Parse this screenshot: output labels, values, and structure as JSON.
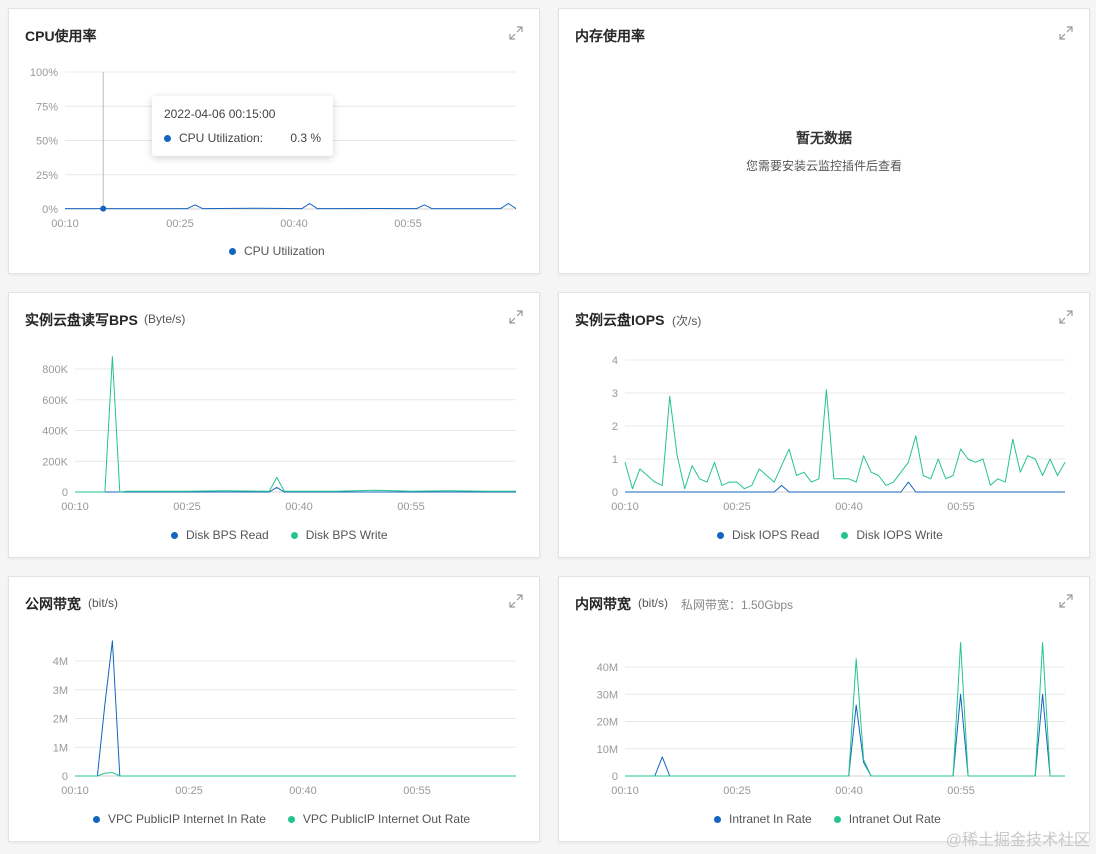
{
  "colors": {
    "blue": "#1464c0",
    "green": "#24c48c",
    "grid": "#e8e8e8",
    "tick": "#999999"
  },
  "cpu": {
    "title": "CPU使用率",
    "tooltip": {
      "time": "2022-04-06 00:15:00",
      "series": "CPU Utilization:",
      "value": "0.3 %"
    },
    "legend": [
      "CPU Utilization"
    ]
  },
  "memory": {
    "title": "内存使用率",
    "empty_title": "暂无数据",
    "empty_desc": "您需要安装云监控插件后查看"
  },
  "disk_bps": {
    "title": "实例云盘读写BPS",
    "unit": "(Byte/s)",
    "legend": [
      "Disk BPS Read",
      "Disk BPS Write"
    ]
  },
  "disk_iops": {
    "title": "实例云盘IOPS",
    "unit": "(次/s)",
    "legend": [
      "Disk IOPS Read",
      "Disk IOPS Write"
    ]
  },
  "public_bw": {
    "title": "公网带宽",
    "unit": "(bit/s)",
    "legend": [
      "VPC PublicIP Internet In Rate",
      "VPC PublicIP Internet Out Rate"
    ]
  },
  "private_bw": {
    "title": "内网带宽",
    "unit": "(bit/s)",
    "extra": "私网带宽：1.50Gbps",
    "legend": [
      "Intranet In Rate",
      "Intranet Out Rate"
    ]
  },
  "watermark": "@稀土掘金技术社区",
  "chart_data": [
    {
      "id": "cpu",
      "type": "line",
      "x_ticks": [
        "00:10",
        "00:25",
        "00:40",
        "00:55"
      ],
      "y_ticks": [
        "100%",
        "75%",
        "50%",
        "25%",
        "0%"
      ],
      "ylim": [
        0,
        100
      ],
      "xlim": [
        10,
        69
      ],
      "series": [
        {
          "name": "CPU Utilization",
          "color": "#1464c0",
          "x": [
            10,
            15,
            26,
            27,
            28,
            35,
            41,
            42,
            43,
            50,
            56,
            57,
            58,
            67,
            68,
            69
          ],
          "y": [
            0.3,
            0.3,
            0.3,
            3,
            0.3,
            0.5,
            0.3,
            4,
            0.3,
            0.4,
            0.3,
            3,
            0.3,
            0.3,
            4,
            0.3
          ]
        }
      ]
    },
    {
      "id": "disk_bps",
      "type": "line",
      "x_ticks": [
        "00:10",
        "00:25",
        "00:40",
        "00:55"
      ],
      "y_ticks": [
        "800K",
        "600K",
        "400K",
        "200K",
        "0"
      ],
      "ylim": [
        0,
        900
      ],
      "xlim": [
        10,
        69
      ],
      "series": [
        {
          "name": "Disk BPS Read",
          "color": "#1464c0",
          "x": [
            10,
            15,
            16,
            17,
            36,
            37,
            38,
            69
          ],
          "y": [
            0,
            0,
            0,
            0,
            0,
            30,
            0,
            0
          ]
        },
        {
          "name": "Disk BPS Write",
          "color": "#24c48c",
          "x": [
            10,
            14,
            15,
            16,
            17,
            20,
            25,
            30,
            36,
            37,
            38,
            45,
            50,
            55,
            60,
            65,
            69
          ],
          "y": [
            0,
            0,
            880,
            0,
            5,
            5,
            5,
            8,
            5,
            95,
            5,
            5,
            12,
            5,
            8,
            5,
            5
          ]
        }
      ]
    },
    {
      "id": "disk_iops",
      "type": "line",
      "x_ticks": [
        "00:10",
        "00:25",
        "00:40",
        "00:55"
      ],
      "y_ticks": [
        "4",
        "3",
        "2",
        "1",
        "0"
      ],
      "ylim": [
        0,
        4
      ],
      "xlim": [
        10,
        69
      ],
      "series": [
        {
          "name": "Disk IOPS Read",
          "color": "#1464c0",
          "x": [
            10,
            30,
            31,
            32,
            47,
            48,
            49,
            69
          ],
          "y": [
            0,
            0,
            0.2,
            0,
            0,
            0.3,
            0,
            0
          ]
        },
        {
          "name": "Disk IOPS Write",
          "color": "#24c48c",
          "x": [
            10,
            11,
            12,
            13,
            14,
            15,
            16,
            17,
            18,
            19,
            20,
            21,
            22,
            23,
            24,
            25,
            26,
            27,
            28,
            29,
            30,
            31,
            32,
            33,
            34,
            35,
            36,
            37,
            38,
            39,
            40,
            41,
            42,
            43,
            44,
            45,
            46,
            47,
            48,
            49,
            50,
            51,
            52,
            53,
            54,
            55,
            56,
            57,
            58,
            59,
            60,
            61,
            62,
            63,
            64,
            65,
            66,
            67,
            68,
            69
          ],
          "y": [
            0.9,
            0.1,
            0.7,
            0.5,
            0.3,
            0.2,
            2.9,
            1.1,
            0.1,
            0.8,
            0.4,
            0.3,
            0.9,
            0.2,
            0.3,
            0.3,
            0.1,
            0.2,
            0.7,
            0.5,
            0.3,
            0.8,
            1.3,
            0.5,
            0.6,
            0.3,
            0.4,
            3.1,
            0.4,
            0.4,
            0.4,
            0.3,
            1.1,
            0.6,
            0.5,
            0.2,
            0.3,
            0.6,
            0.9,
            1.7,
            0.5,
            0.4,
            1.0,
            0.4,
            0.5,
            1.3,
            1.0,
            0.9,
            1.0,
            0.2,
            0.4,
            0.3,
            1.6,
            0.6,
            1.1,
            1.0,
            0.5,
            1.0,
            0.5,
            0.9
          ]
        }
      ]
    },
    {
      "id": "public_bw",
      "type": "line",
      "x_ticks": [
        "00:10",
        "00:25",
        "00:40",
        "00:55"
      ],
      "y_ticks": [
        "4M",
        "3M",
        "2M",
        "1M",
        "0"
      ],
      "ylim": [
        0,
        5
      ],
      "xlim": [
        10,
        69
      ],
      "series": [
        {
          "name": "VPC PublicIP Internet In Rate",
          "color": "#1464c0",
          "x": [
            10,
            13,
            14,
            15,
            16,
            69
          ],
          "y": [
            0,
            0,
            2.5,
            4.7,
            0,
            0
          ]
        },
        {
          "name": "VPC PublicIP Internet Out Rate",
          "color": "#24c48c",
          "x": [
            10,
            13,
            14,
            15,
            16,
            69
          ],
          "y": [
            0,
            0,
            0.1,
            0.12,
            0,
            0
          ]
        }
      ]
    },
    {
      "id": "private_bw",
      "type": "line",
      "x_ticks": [
        "00:10",
        "00:25",
        "00:40",
        "00:55"
      ],
      "y_ticks": [
        "40M",
        "30M",
        "20M",
        "10M",
        "0"
      ],
      "ylim": [
        0,
        50
      ],
      "xlim": [
        10,
        69
      ],
      "series": [
        {
          "name": "Intranet In Rate",
          "color": "#1464c0",
          "x": [
            10,
            14,
            15,
            16,
            40,
            41,
            42,
            43,
            54,
            55,
            56,
            65,
            66,
            67,
            69
          ],
          "y": [
            0,
            0,
            7,
            0,
            0,
            26,
            5,
            0,
            0,
            30,
            0,
            0,
            30,
            0,
            0
          ]
        },
        {
          "name": "Intranet Out Rate",
          "color": "#24c48c",
          "x": [
            10,
            40,
            41,
            42,
            43,
            54,
            55,
            56,
            65,
            66,
            67,
            69
          ],
          "y": [
            0,
            0,
            43,
            6,
            0,
            0,
            49,
            0,
            0,
            49,
            0,
            0
          ]
        }
      ]
    }
  ]
}
